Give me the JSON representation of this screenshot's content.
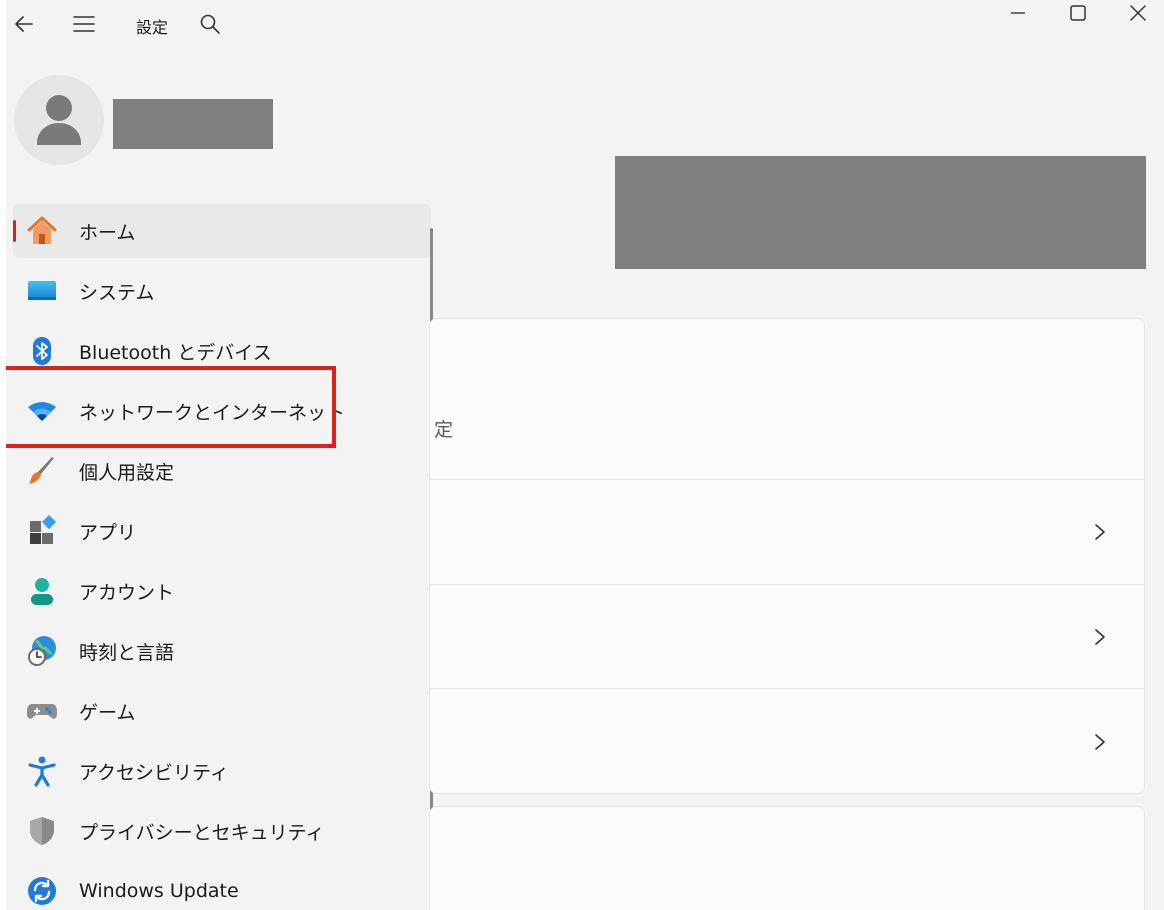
{
  "window": {
    "title": "設定"
  },
  "nav": {
    "items": [
      {
        "label": "ホーム",
        "icon": "home-icon",
        "selected": true
      },
      {
        "label": "システム",
        "icon": "system-icon"
      },
      {
        "label": "Bluetooth とデバイス",
        "icon": "bluetooth-icon"
      },
      {
        "label": "ネットワークとインターネット",
        "icon": "wifi-icon",
        "highlighted": true
      },
      {
        "label": "個人用設定",
        "icon": "paintbrush-icon"
      },
      {
        "label": "アプリ",
        "icon": "apps-icon"
      },
      {
        "label": "アカウント",
        "icon": "account-icon"
      },
      {
        "label": "時刻と言語",
        "icon": "time-language-icon"
      },
      {
        "label": "ゲーム",
        "icon": "gamepad-icon"
      },
      {
        "label": "アクセシビリティ",
        "icon": "accessibility-icon"
      },
      {
        "label": "プライバシーとセキュリティ",
        "icon": "shield-icon"
      },
      {
        "label": "Windows Update",
        "icon": "update-icon"
      }
    ]
  },
  "content": {
    "partial_text": "定"
  },
  "colors": {
    "selection_indicator": "#c42b1c",
    "highlight_box": "#e0201b",
    "redaction": "#7f7f81"
  }
}
